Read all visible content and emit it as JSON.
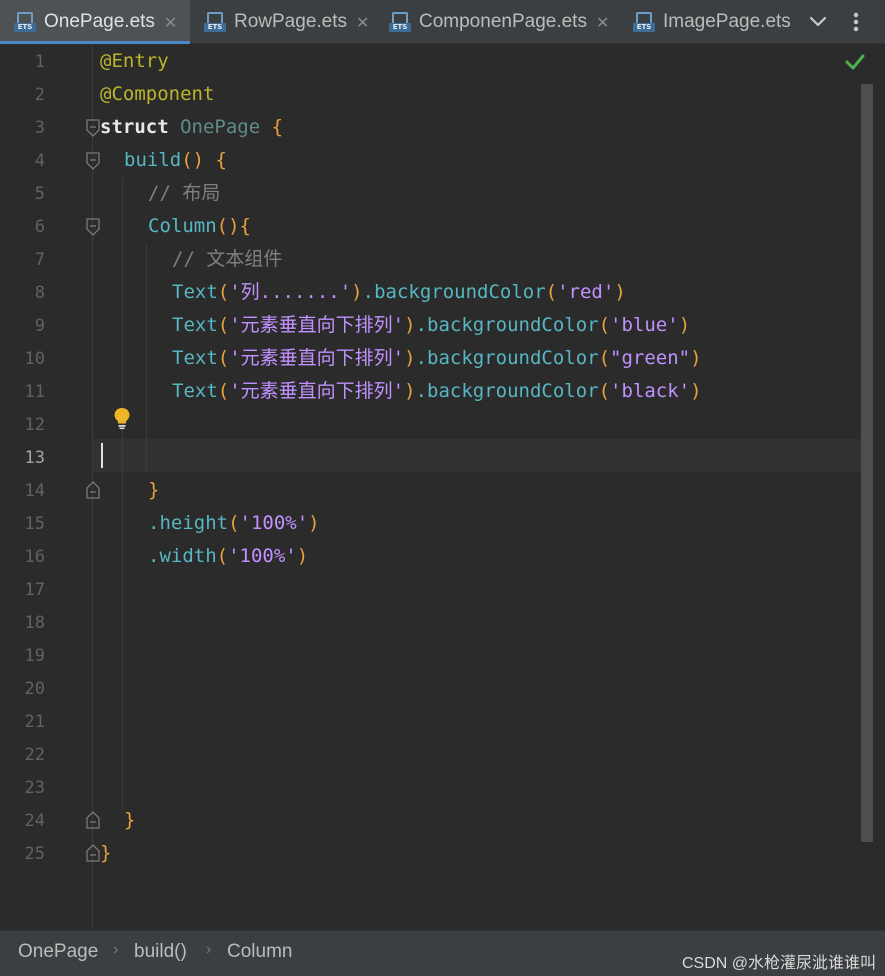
{
  "tabs": [
    {
      "label": "OnePage.ets",
      "active": true,
      "closable": true,
      "icon": "ets-file-icon"
    },
    {
      "label": "RowPage.ets",
      "active": false,
      "closable": true,
      "icon": "ets-file-icon"
    },
    {
      "label": "ComponenPage.ets",
      "active": false,
      "closable": true,
      "icon": "ets-file-icon"
    },
    {
      "label": "ImagePage.ets",
      "active": false,
      "closable": false,
      "icon": "ets-file-icon"
    }
  ],
  "tab_close_glyph": "✕",
  "ets_icon_label": "ETS",
  "editor": {
    "current_line": 13,
    "line_numbers": [
      "1",
      "2",
      "3",
      "4",
      "5",
      "6",
      "7",
      "8",
      "9",
      "10",
      "11",
      "12",
      "13",
      "14",
      "15",
      "16",
      "17",
      "18",
      "19",
      "20",
      "21",
      "22",
      "23",
      "24",
      "25"
    ],
    "code": {
      "l1": {
        "a": "@Entry"
      },
      "l2": {
        "a": "@Component"
      },
      "l3": {
        "a": "struct",
        "b": " ",
        "c": "OnePage",
        "d": " ",
        "e": "{"
      },
      "l4": {
        "a": "build",
        "b": "()",
        "c": " ",
        "d": "{"
      },
      "l5": {
        "a": "// 布局"
      },
      "l6": {
        "a": "Column",
        "b": "(){"
      },
      "l7": {
        "a": "// 文本组件"
      },
      "l8": {
        "a": "Text",
        "b": "(",
        "c": "'列.......'",
        "d": ")",
        "e": ".backgroundColor",
        "f": "(",
        "g": "'red'",
        "h": ")"
      },
      "l9": {
        "a": "Text",
        "b": "(",
        "c": "'元素垂直向下排列'",
        "d": ")",
        "e": ".backgroundColor",
        "f": "(",
        "g": "'blue'",
        "h": ")"
      },
      "l10": {
        "a": "Text",
        "b": "(",
        "c": "'元素垂直向下排列'",
        "d": ")",
        "e": ".backgroundColor",
        "f": "(",
        "g": "\"green\"",
        "h": ")"
      },
      "l11": {
        "a": "Text",
        "b": "(",
        "c": "'元素垂直向下排列'",
        "d": ")",
        "e": ".backgroundColor",
        "f": "(",
        "g": "'black'",
        "h": ")"
      },
      "l14": {
        "a": "}"
      },
      "l15": {
        "a": ".height",
        "b": "(",
        "c": "'100%'",
        "d": ")"
      },
      "l16": {
        "a": ".width",
        "b": "(",
        "c": "'100%'",
        "d": ")"
      },
      "l24": {
        "a": "}"
      },
      "l25": {
        "a": "}"
      }
    }
  },
  "breadcrumb": {
    "items": [
      "OnePage",
      "build()",
      "Column"
    ],
    "separator": "›"
  },
  "watermark": "CSDN @水枪灌尿泚谁谁叫",
  "colors": {
    "background": "#2b2b2b",
    "tab_bar": "#3c3f41",
    "active_tab_underline": "#4a88c7",
    "annotation": "#bbb529",
    "function": "#56b6c2",
    "string": "#c191ff",
    "bracket": "#e8a23c",
    "comment": "#808080",
    "check_ok": "#4caf50",
    "bulb": "#f0b429"
  }
}
